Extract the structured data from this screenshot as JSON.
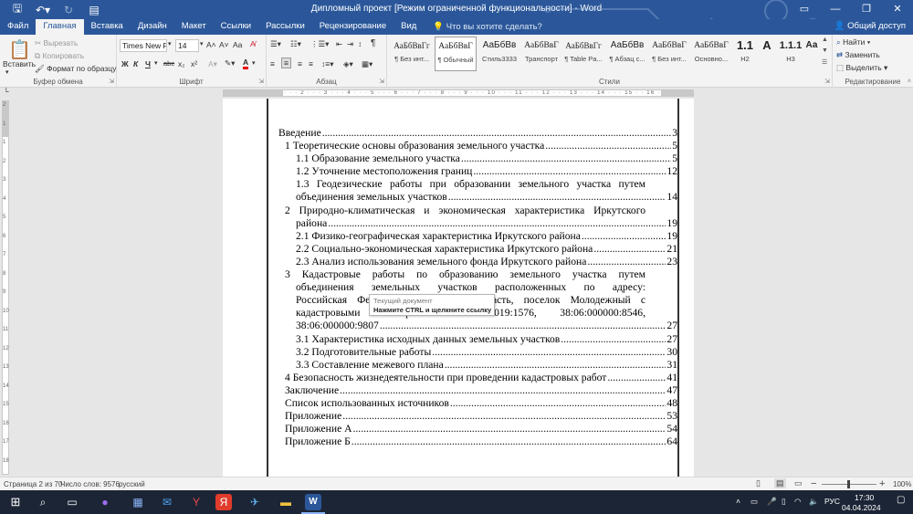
{
  "titlebar": {
    "title": "Дипломный проект [Режим ограниченной функциональности] - Word",
    "qa_icons": [
      "save-icon",
      "undo-icon",
      "redo-icon",
      "customize-icon"
    ],
    "controls": [
      "ribbon-display-icon",
      "minimize-icon",
      "restore-icon",
      "close-icon"
    ]
  },
  "tabs": [
    "Файл",
    "Главная",
    "Вставка",
    "Дизайн",
    "Макет",
    "Ссылки",
    "Рассылки",
    "Рецензирование",
    "Вид"
  ],
  "active_tab": "Главная",
  "tellme": "Что вы хотите сделать?",
  "share": "Общий доступ",
  "clipboard": {
    "paste": "Вставить",
    "cut": "Вырезать",
    "copy": "Копировать",
    "format_painter": "Формат по образцу",
    "label": "Буфер обмена"
  },
  "font": {
    "name": "Times New R",
    "size": "14",
    "label": "Шрифт",
    "grow": "A˄",
    "shrink": "A˅",
    "case": "Aa",
    "bold": "Ж",
    "italic": "К",
    "underline": "Ч",
    "strike": "abc",
    "sub": "x₂",
    "sup": "x²",
    "color": "A"
  },
  "paragraph": {
    "label": "Абзац"
  },
  "styles": {
    "label": "Стили",
    "items": [
      {
        "sample": "АаБбВвГг",
        "name": "¶ Без инт..."
      },
      {
        "sample": "АаБбВвГ",
        "name": "¶ Обычный"
      },
      {
        "sample": "АаБбВв",
        "name": "Стиль3333"
      },
      {
        "sample": "АаБбВвГ",
        "name": "Транспорт"
      },
      {
        "sample": "АаБбВвГг",
        "name": "¶ Table Pa..."
      },
      {
        "sample": "АаБбВв",
        "name": "¶ Абзац с..."
      },
      {
        "sample": "АаБбВвГ",
        "name": "¶ Без инт..."
      },
      {
        "sample": "АаБбВвГ",
        "name": "Основно..."
      },
      {
        "sample": "1.1",
        "name": "H2"
      },
      {
        "sample": "А",
        "name": ""
      },
      {
        "sample": "1.1.1",
        "name": "H3"
      },
      {
        "sample": "Аа",
        "name": ""
      }
    ]
  },
  "editing": {
    "find": "Найти",
    "replace": "Заменить",
    "select": "Выделить",
    "label": "Редактирование"
  },
  "ruler": {
    "h_marks": "· 1 · 2 · 1 · · · 1 · · · 2 · · · 3 · · · 4 · · · 5 · · · 6 · · · 7 · · · 8 · · · 9 · · · 10 · · · 11 · · · 12 · · · 13 · · · 14 · · · 15 · · 16 · · 17 · 18",
    "v_marks": [
      "2",
      "1",
      "1",
      "2",
      "3",
      "4",
      "5",
      "6",
      "7",
      "8",
      "9",
      "10",
      "11",
      "12",
      "13",
      "14",
      "15",
      "16",
      "17",
      "18"
    ]
  },
  "toc": [
    {
      "title": "Введение",
      "page": "3",
      "level": 0
    },
    {
      "title": "1 Теоретические основы образования земельного участка",
      "page": "5",
      "level": 1
    },
    {
      "title": "1.1 Образование земельного участка",
      "page": "5",
      "level": 2
    },
    {
      "title": "1.2 Уточнение местоположения границ",
      "page": "12",
      "level": 2
    },
    {
      "title_lines": [
        "1.3 Геодезические работы при образовании земельного участка путем"
      ],
      "title": "объединения земельных участков",
      "page": "14",
      "level": 2
    },
    {
      "title_lines": [
        "2 Природно-климатическая и экономическая характеристика Иркутского"
      ],
      "title": "района",
      "page": "19",
      "level": 1
    },
    {
      "title": "2.1 Физико-географическая характеристика Иркутского района",
      "page": "19",
      "level": 2
    },
    {
      "title": "2.2 Социально-экономическая характеристика Иркутского района",
      "page": "21",
      "level": 2
    },
    {
      "title": "2.3 Анализ использования земельного фонда Иркутского района",
      "page": "23",
      "level": 2
    },
    {
      "title_lines": [
        "3 Кадастровые работы по образованию земельного участка путем",
        "объединения земельных участков расположенных по адресу:",
        "Российская Федерация, Иркутская область, поселок Молодежный с",
        "кадастровыми номерами 38:06:000019:1576, 38:06:000000:8546,"
      ],
      "title": "38:06:000000:9807",
      "page": "27",
      "level": 1
    },
    {
      "title": "3.1 Характеристика исходных данных земельных участков",
      "page": "27",
      "level": 2
    },
    {
      "title": "3.2 Подготовительные работы",
      "page": "30",
      "level": 2
    },
    {
      "title": "3.3 Составление межевого плана",
      "page": "31",
      "level": 2
    },
    {
      "title": "4 Безопасность жизнедеятельности при проведении кадастровых работ",
      "page": "41",
      "level": 1
    },
    {
      "title": "Заключение",
      "page": "47",
      "level": 1
    },
    {
      "title": "Список использованных источников",
      "page": "48",
      "level": 1
    },
    {
      "title": "Приложение",
      "page": "53",
      "level": 1
    },
    {
      "title": "Приложение А",
      "page": "54",
      "level": 1
    },
    {
      "title": "Приложение Б",
      "page": "64",
      "level": 1
    }
  ],
  "tooltip": {
    "line1": "Текущий документ",
    "line2": "Нажмите CTRL и щелкните ссылку"
  },
  "status": {
    "page": "Страница 2 из 70",
    "words": "Число слов: 9576",
    "lang": "русский",
    "zoom": "100%",
    "zoom_minus": "−",
    "zoom_plus": "+"
  },
  "taskbar": {
    "lang": "РУС",
    "time": "17:30",
    "date": "04.04.2024",
    "apps": [
      "windows-start-icon",
      "search-icon",
      "alice-icon",
      "store-icon",
      "mail-icon",
      "yandex-browser-icon",
      "yandex-icon",
      "telegram-icon",
      "file-explorer-icon",
      "word-icon"
    ]
  },
  "colors": {
    "word_blue": "#2b579a",
    "taskbar": "#1c2536"
  }
}
